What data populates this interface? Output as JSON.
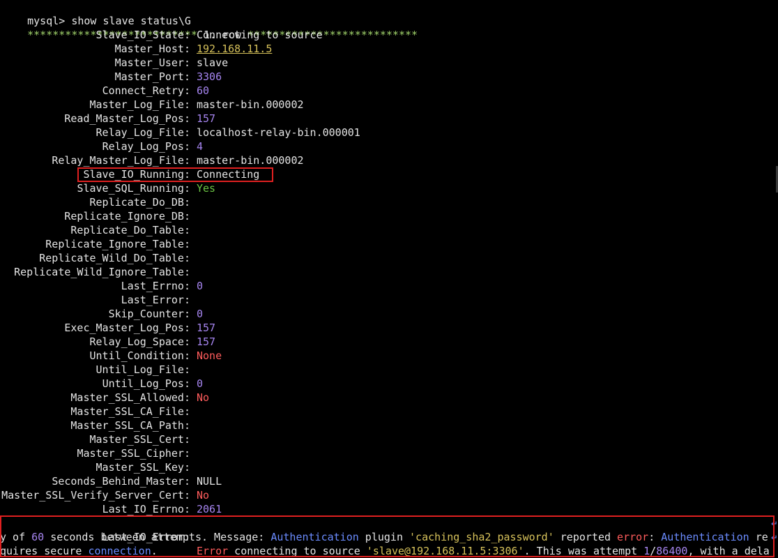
{
  "prompt": "mysql> ",
  "command": "show slave status\\G",
  "row_header": {
    "stars_left": "***************************",
    "row_label": " 1. row ",
    "stars_right": "***************************"
  },
  "fields": [
    {
      "key": "Slave_IO_State",
      "value": "Connecting to source",
      "color": "default"
    },
    {
      "key": "Master_Host",
      "value": "192.168.11.5",
      "color": "yellow-underline"
    },
    {
      "key": "Master_User",
      "value": "slave",
      "color": "default"
    },
    {
      "key": "Master_Port",
      "value": "3306",
      "color": "purple"
    },
    {
      "key": "Connect_Retry",
      "value": "60",
      "color": "purple"
    },
    {
      "key": "Master_Log_File",
      "value": "master-bin.000002",
      "color": "default"
    },
    {
      "key": "Read_Master_Log_Pos",
      "value": "157",
      "color": "purple"
    },
    {
      "key": "Relay_Log_File",
      "value": "localhost-relay-bin.000001",
      "color": "default"
    },
    {
      "key": "Relay_Log_Pos",
      "value": "4",
      "color": "purple"
    },
    {
      "key": "Relay_Master_Log_File",
      "value": "master-bin.000002",
      "color": "default"
    },
    {
      "key": "Slave_IO_Running",
      "value": "Connecting",
      "color": "default"
    },
    {
      "key": "Slave_SQL_Running",
      "value": "Yes",
      "color": "green"
    },
    {
      "key": "Replicate_Do_DB",
      "value": "",
      "color": "default"
    },
    {
      "key": "Replicate_Ignore_DB",
      "value": "",
      "color": "default"
    },
    {
      "key": "Replicate_Do_Table",
      "value": "",
      "color": "default"
    },
    {
      "key": "Replicate_Ignore_Table",
      "value": "",
      "color": "default"
    },
    {
      "key": "Replicate_Wild_Do_Table",
      "value": "",
      "color": "default"
    },
    {
      "key": "Replicate_Wild_Ignore_Table",
      "value": "",
      "color": "default"
    },
    {
      "key": "Last_Errno",
      "value": "0",
      "color": "purple"
    },
    {
      "key": "Last_Error",
      "value": "",
      "color": "default"
    },
    {
      "key": "Skip_Counter",
      "value": "0",
      "color": "purple"
    },
    {
      "key": "Exec_Master_Log_Pos",
      "value": "157",
      "color": "purple"
    },
    {
      "key": "Relay_Log_Space",
      "value": "157",
      "color": "purple"
    },
    {
      "key": "Until_Condition",
      "value": "None",
      "color": "red"
    },
    {
      "key": "Until_Log_File",
      "value": "",
      "color": "default"
    },
    {
      "key": "Until_Log_Pos",
      "value": "0",
      "color": "purple"
    },
    {
      "key": "Master_SSL_Allowed",
      "value": "No",
      "color": "red"
    },
    {
      "key": "Master_SSL_CA_File",
      "value": "",
      "color": "default"
    },
    {
      "key": "Master_SSL_CA_Path",
      "value": "",
      "color": "default"
    },
    {
      "key": "Master_SSL_Cert",
      "value": "",
      "color": "default"
    },
    {
      "key": "Master_SSL_Cipher",
      "value": "",
      "color": "default"
    },
    {
      "key": "Master_SSL_Key",
      "value": "",
      "color": "default"
    },
    {
      "key": "Seconds_Behind_Master",
      "value": "NULL",
      "color": "default"
    },
    {
      "key": "Master_SSL_Verify_Server_Cert",
      "value": "No",
      "color": "red"
    },
    {
      "key": "Last_IO_Errno",
      "value": "2061",
      "color": "purple"
    }
  ],
  "last_io_error": {
    "key": "Last_IO_Error",
    "line1": [
      {
        "text": "Error",
        "color": "red"
      },
      {
        "text": " connecting to source ",
        "color": "default"
      },
      {
        "text": "'slave@192.168.11.5:3306'",
        "color": "yellow"
      },
      {
        "text": ". This was attempt ",
        "color": "default"
      },
      {
        "text": "1",
        "color": "purple"
      },
      {
        "text": "/",
        "color": "default"
      },
      {
        "text": "86400",
        "color": "purple"
      },
      {
        "text": ", with a dela",
        "color": "default"
      }
    ],
    "line2": [
      {
        "text": "y of ",
        "color": "default"
      },
      {
        "text": "60",
        "color": "purple"
      },
      {
        "text": " seconds between attempts. Message",
        "color": "default"
      },
      {
        "text": ": ",
        "color": "default"
      },
      {
        "text": "Authentication",
        "color": "blue"
      },
      {
        "text": " plugin ",
        "color": "default"
      },
      {
        "text": "'caching_sha2_password'",
        "color": "yellow"
      },
      {
        "text": " reported ",
        "color": "default"
      },
      {
        "text": "error",
        "color": "red"
      },
      {
        "text": ": ",
        "color": "default"
      },
      {
        "text": "Authentication",
        "color": "blue"
      },
      {
        "text": " re",
        "color": "default"
      }
    ],
    "line3": [
      {
        "text": "quires secure ",
        "color": "default"
      },
      {
        "text": "connection",
        "color": "blue"
      },
      {
        "text": ".",
        "color": "default"
      }
    ],
    "wrap_marker": "↵"
  },
  "colors": {
    "background": "#000000",
    "default_text": "#e5e5e5",
    "green": "#6cc644",
    "purple": "#a685f0",
    "red": "#ff5c5c",
    "yellow": "#d7c25b",
    "blue": "#6b8cff",
    "highlight_border": "#e02020"
  }
}
